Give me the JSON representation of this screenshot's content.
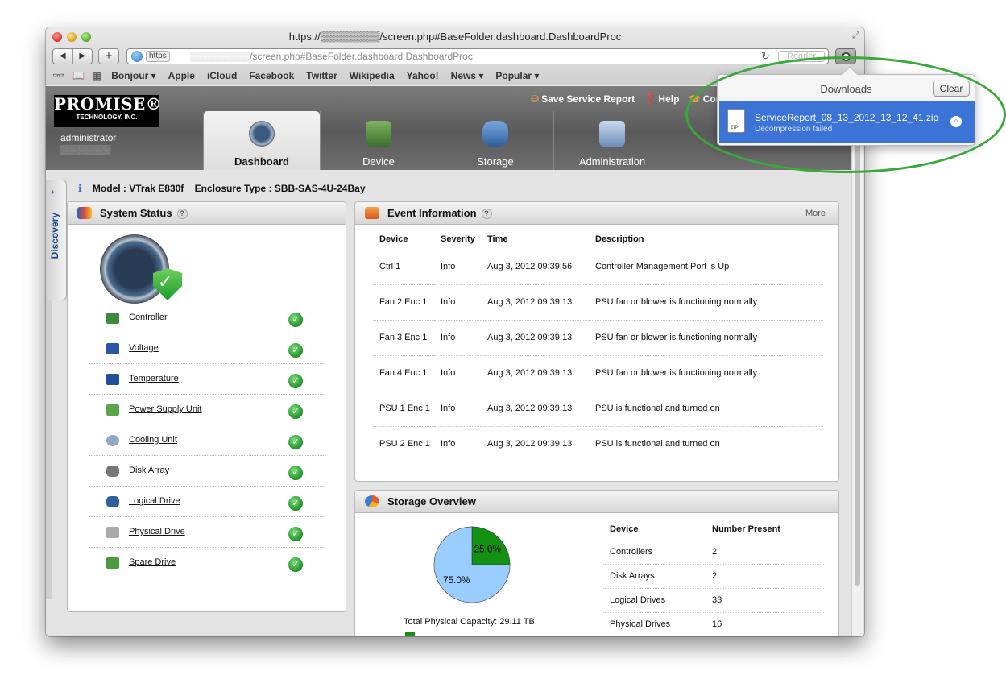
{
  "browser": {
    "window_title": "https://▒▒▒▒▒▒▒▒/screen.php#BaseFolder.dashboard.DashboardProc",
    "url_scheme": "https",
    "url_host": "▒▒▒▒▒▒▒▒▒",
    "url_path": "/screen.php#BaseFolder.dashboard.DashboardProc",
    "reader_label": "Reader",
    "nav_back": "◀",
    "nav_forward": "▶",
    "new_tab": "+",
    "reload": "↻",
    "bookmarks": [
      "Bonjour ▾",
      "Apple",
      "iCloud",
      "Facebook",
      "Twitter",
      "Wikipedia",
      "Yahoo!",
      "News ▾",
      "Popular ▾"
    ]
  },
  "downloads": {
    "title": "Downloads",
    "clear_label": "Clear",
    "item_filename": "ServiceReport_08_13_2012_13_12_41.zip",
    "item_status": "Decompression failed",
    "file_type": "ZIP"
  },
  "header": {
    "logo_line1": "PROMISE®",
    "logo_line2": "TECHNOLOGY, INC.",
    "user": "administrator",
    "user_ip": "▒▒▒▒▒▒▒▒",
    "save_report": "Save Service Report",
    "help": "Help",
    "contact": "Cont",
    "tabs": [
      "Dashboard",
      "Device",
      "Storage",
      "Administration"
    ]
  },
  "discovery_label": "Discovery",
  "model": {
    "model_label": "Model :",
    "model_value": "VTrak E830f",
    "enclosure_label": "Enclosure Type :",
    "enclosure_value": "SBB-SAS-4U-24Bay"
  },
  "system_status": {
    "title": "System Status",
    "items": [
      "Controller",
      "Voltage",
      "Temperature",
      "Power Supply Unit",
      "Cooling Unit",
      "Disk Array",
      "Logical Drive",
      "Physical Drive",
      "Spare Drive"
    ]
  },
  "events": {
    "title": "Event Information",
    "more": "More",
    "columns": [
      "Device",
      "Severity",
      "Time",
      "Description"
    ],
    "rows": [
      [
        "Ctrl 1",
        "Info",
        "Aug 3, 2012 09:39:56",
        "Controller Management Port is Up"
      ],
      [
        "Fan 2 Enc 1",
        "Info",
        "Aug 3, 2012 09:39:13",
        "PSU fan or blower is functioning normally"
      ],
      [
        "Fan 3 Enc 1",
        "Info",
        "Aug 3, 2012 09:39:13",
        "PSU fan or blower is functioning normally"
      ],
      [
        "Fan 4 Enc 1",
        "Info",
        "Aug 3, 2012 09:39:13",
        "PSU fan or blower is functioning normally"
      ],
      [
        "PSU 1 Enc 1",
        "Info",
        "Aug 3, 2012 09:39:13",
        "PSU is functional and turned on"
      ],
      [
        "PSU 2 Enc 1",
        "Info",
        "Aug 3, 2012 09:39:13",
        "PSU is functional and turned on"
      ]
    ]
  },
  "storage": {
    "title": "Storage Overview",
    "total_capacity": "Total Physical Capacity: 29.11 TB",
    "columns": [
      "Device",
      "Number Present"
    ],
    "rows": [
      [
        "Controllers",
        "2"
      ],
      [
        "Disk Arrays",
        "2"
      ],
      [
        "Logical Drives",
        "33"
      ],
      [
        "Physical Drives",
        "16"
      ]
    ]
  },
  "chart_data": {
    "type": "pie",
    "slices": [
      {
        "label": "25.0%",
        "value": 25.0,
        "color": "#139113"
      },
      {
        "label": "75.0%",
        "value": 75.0,
        "color": "#99ccff"
      }
    ]
  }
}
